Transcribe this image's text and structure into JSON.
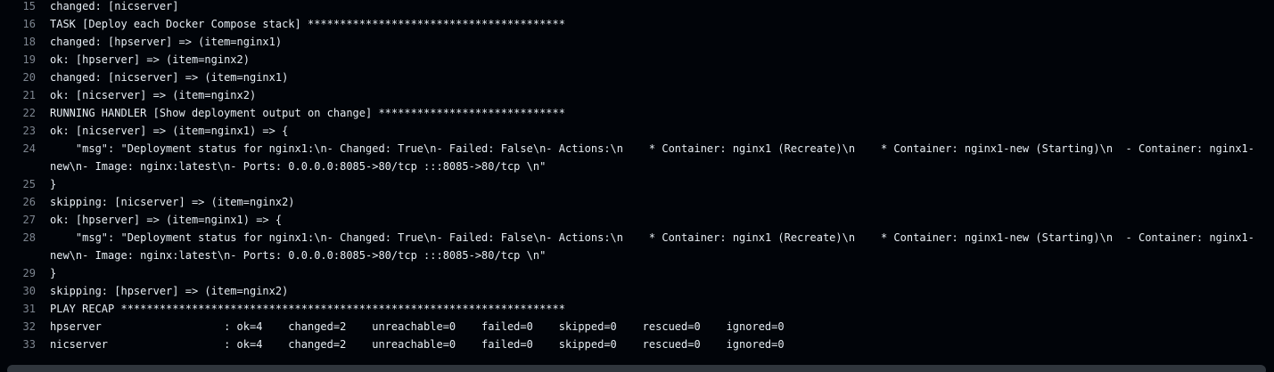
{
  "log": {
    "lines": [
      {
        "n": "15",
        "text": "changed: [nicserver]"
      },
      {
        "n": "16",
        "text": "TASK [Deploy each Docker Compose stack] ****************************************"
      },
      {
        "n": "18",
        "text": "changed: [hpserver] => (item=nginx1)"
      },
      {
        "n": "19",
        "text": "ok: [hpserver] => (item=nginx2)"
      },
      {
        "n": "20",
        "text": "changed: [nicserver] => (item=nginx1)"
      },
      {
        "n": "21",
        "text": "ok: [nicserver] => (item=nginx2)"
      },
      {
        "n": "22",
        "text": "RUNNING HANDLER [Show deployment output on change] *****************************"
      },
      {
        "n": "23",
        "text": "ok: [nicserver] => (item=nginx1) => {"
      },
      {
        "n": "24",
        "text": "    \"msg\": \"Deployment status for nginx1:\\n- Changed: True\\n- Failed: False\\n- Actions:\\n    * Container: nginx1 (Recreate)\\n    * Container: nginx1-new (Starting)\\n  - Container: nginx1-new\\n- Image: nginx:latest\\n- Ports: 0.0.0.0:8085->80/tcp :::8085->80/tcp \\n\""
      },
      {
        "n": "25",
        "text": "}"
      },
      {
        "n": "26",
        "text": "skipping: [nicserver] => (item=nginx2)"
      },
      {
        "n": "27",
        "text": "ok: [hpserver] => (item=nginx1) => {"
      },
      {
        "n": "28",
        "text": "    \"msg\": \"Deployment status for nginx1:\\n- Changed: True\\n- Failed: False\\n- Actions:\\n    * Container: nginx1 (Recreate)\\n    * Container: nginx1-new (Starting)\\n  - Container: nginx1-new\\n- Image: nginx:latest\\n- Ports: 0.0.0.0:8085->80/tcp :::8085->80/tcp \\n\""
      },
      {
        "n": "29",
        "text": "}"
      },
      {
        "n": "30",
        "text": "skipping: [hpserver] => (item=nginx2)"
      },
      {
        "n": "31",
        "text": "PLAY RECAP *********************************************************************"
      },
      {
        "n": "32",
        "text": "hpserver                   : ok=4    changed=2    unreachable=0    failed=0    skipped=0    rescued=0    ignored=0"
      },
      {
        "n": "33",
        "text": "nicserver                  : ok=4    changed=2    unreachable=0    failed=0    skipped=0    rescued=0    ignored=0"
      }
    ]
  },
  "colors": {
    "background": "#010409",
    "text": "#e6edf3",
    "line_number": "#7d8590",
    "scrollbar": "#30363d"
  }
}
